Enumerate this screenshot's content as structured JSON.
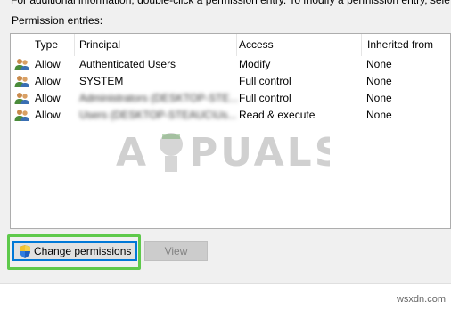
{
  "top_text": "For additional information, double-click a permission entry. To modify a permission entry, sele",
  "permission_entries_label": "Permission entries:",
  "columns": [
    "Type",
    "Principal",
    "Access",
    "Inherited from"
  ],
  "rows": [
    {
      "type": "Allow",
      "principal": "Authenticated Users",
      "access": "Modify",
      "inherited": "None",
      "principal_blurred": false
    },
    {
      "type": "Allow",
      "principal": "SYSTEM",
      "access": "Full control",
      "inherited": "None",
      "principal_blurred": false
    },
    {
      "type": "Allow",
      "principal": "Administrators (DESKTOP-STE...",
      "access": "Full control",
      "inherited": "None",
      "principal_blurred": true
    },
    {
      "type": "Allow",
      "principal": "Users (DESKTOP-STEAUC\\Us...",
      "access": "Read & execute",
      "inherited": "None",
      "principal_blurred": true
    }
  ],
  "watermark_text": "A PUALS",
  "buttons": {
    "change_permissions": "Change permissions",
    "view": "View"
  },
  "site_text": "wsxdn.com",
  "colors": {
    "highlight": "#5ec94b",
    "focus_border": "#0078d7"
  },
  "icons": {
    "user_row": "users-icon",
    "uac": "uac-shield-icon"
  }
}
